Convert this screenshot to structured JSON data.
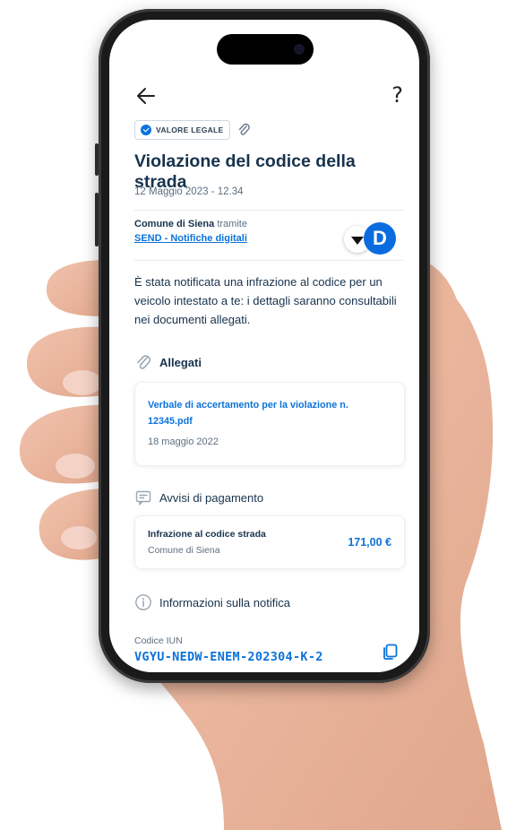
{
  "header": {
    "back_icon": "arrow-left-icon",
    "help_label": "?"
  },
  "badges": {
    "legal_label": "VALORE LEGALE",
    "legal_icon": "verified-check-icon",
    "attachment_icon": "paperclip-icon"
  },
  "notification": {
    "title": "Violazione del codice della strada",
    "date": "12 Maggio 2023  - 12.34",
    "sender_name": "Comune di Siena",
    "sender_via": "tramite",
    "channel_link": "SEND - Notifiche digitali",
    "body": "È stata notificata una infrazione al codice per un veicolo intestato a te: i dettagli saranno consultabili nei documenti allegati."
  },
  "attachments": {
    "section_title": "Allegati",
    "items": [
      {
        "name": "Verbale di accertamento per la violazione n. 12345.pdf",
        "date": "18 maggio 2022"
      }
    ]
  },
  "payments": {
    "section_title": "Avvisi di pagamento",
    "items": [
      {
        "title": "Infrazione al codice strada",
        "subtitle": "Comune di Siena",
        "amount": "171,00 €"
      }
    ]
  },
  "info": {
    "section_title": "Informazioni sulla notifica",
    "iun_label": "Codice IUN",
    "iun_value": "VGYU-NEDW-ENEM-202304-K-2"
  },
  "colors": {
    "primary": "#0b73da",
    "text": "#17324d",
    "muted": "#5c6f82"
  }
}
